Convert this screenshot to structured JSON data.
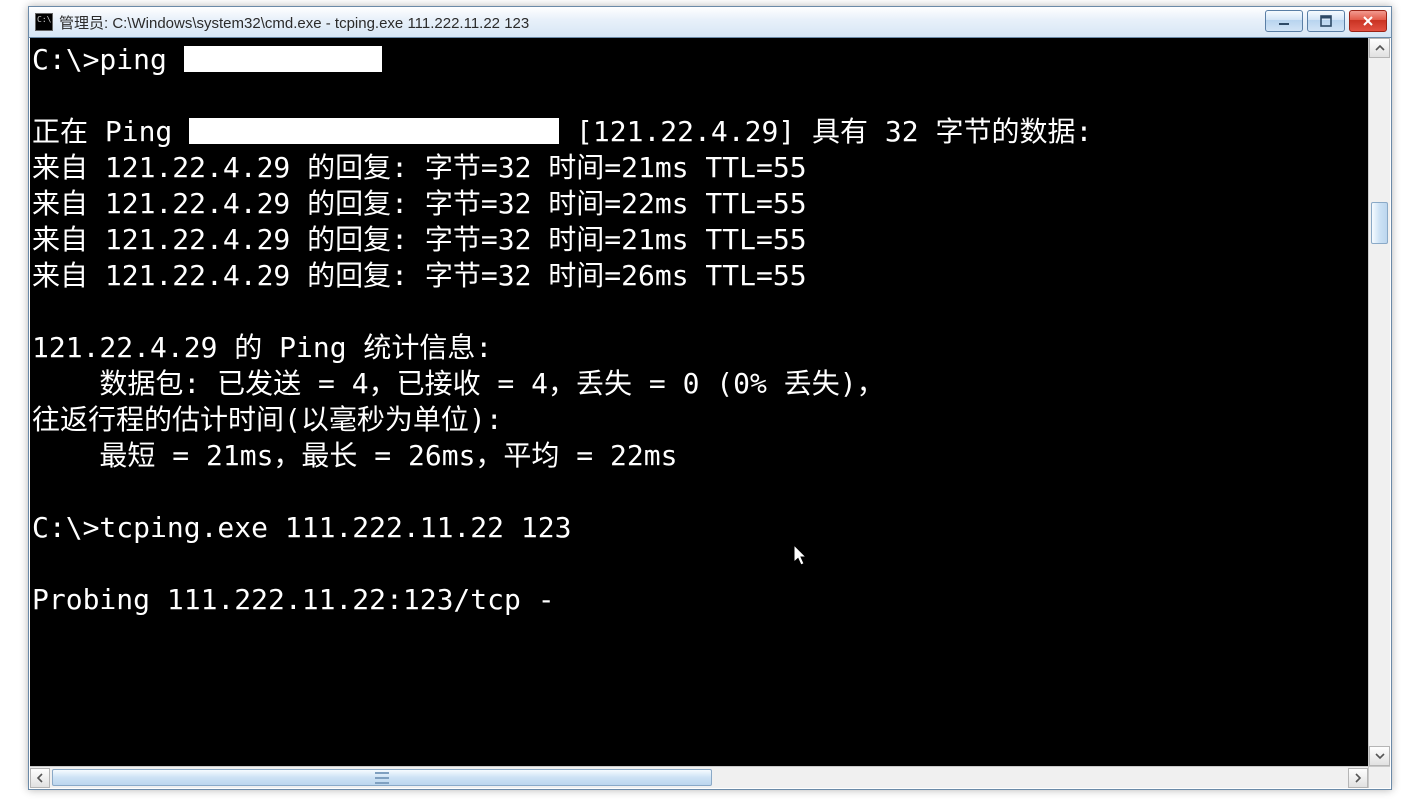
{
  "titlebar": {
    "title": "管理员: C:\\Windows\\system32\\cmd.exe - tcping.exe  111.222.11.22 123"
  },
  "console": {
    "line1_prompt": "C:\\>ping ",
    "blank": "",
    "line2_prefix": "正在 Ping ",
    "line2_suffix": " [121.22.4.29] 具有 32 字节的数据:",
    "reply1": "来自 121.22.4.29 的回复: 字节=32 时间=21ms TTL=55",
    "reply2": "来自 121.22.4.29 的回复: 字节=32 时间=22ms TTL=55",
    "reply3": "来自 121.22.4.29 的回复: 字节=32 时间=21ms TTL=55",
    "reply4": "来自 121.22.4.29 的回复: 字节=32 时间=26ms TTL=55",
    "stats_header": "121.22.4.29 的 Ping 统计信息:",
    "packets": "    数据包: 已发送 = 4，已接收 = 4，丢失 = 0 (0% 丢失)，",
    "rtt_header": "往返行程的估计时间(以毫秒为单位):",
    "rtt_values": "    最短 = 21ms，最长 = 26ms，平均 = 22ms",
    "prompt2": "C:\\>tcping.exe 111.222.11.22 123",
    "probing": "Probing 111.222.11.22:123/tcp -"
  }
}
